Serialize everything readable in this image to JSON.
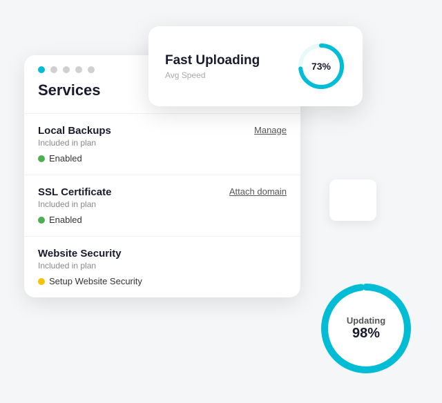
{
  "uploadCard": {
    "title": "Fast Uploading",
    "subtitle": "Avg Speed",
    "percent": "73%",
    "percentNum": 73
  },
  "servicesCard": {
    "title": "Services",
    "items": [
      {
        "name": "Local Backups",
        "plan": "Included in plan",
        "action": "Manage",
        "statusDot": "green",
        "statusText": "Enabled"
      },
      {
        "name": "SSL Certificate",
        "plan": "Included in plan",
        "action": "Attach domain",
        "statusDot": "green",
        "statusText": "Enabled"
      },
      {
        "name": "Website Security",
        "plan": "Included in plan",
        "action": "",
        "statusDot": "yellow",
        "statusText": "Setup Website Security"
      }
    ]
  },
  "updatingCard": {
    "label": "Updating",
    "percent": "98%",
    "percentNum": 98
  },
  "topDots": [
    "teal",
    "gray",
    "gray",
    "gray",
    "gray"
  ]
}
